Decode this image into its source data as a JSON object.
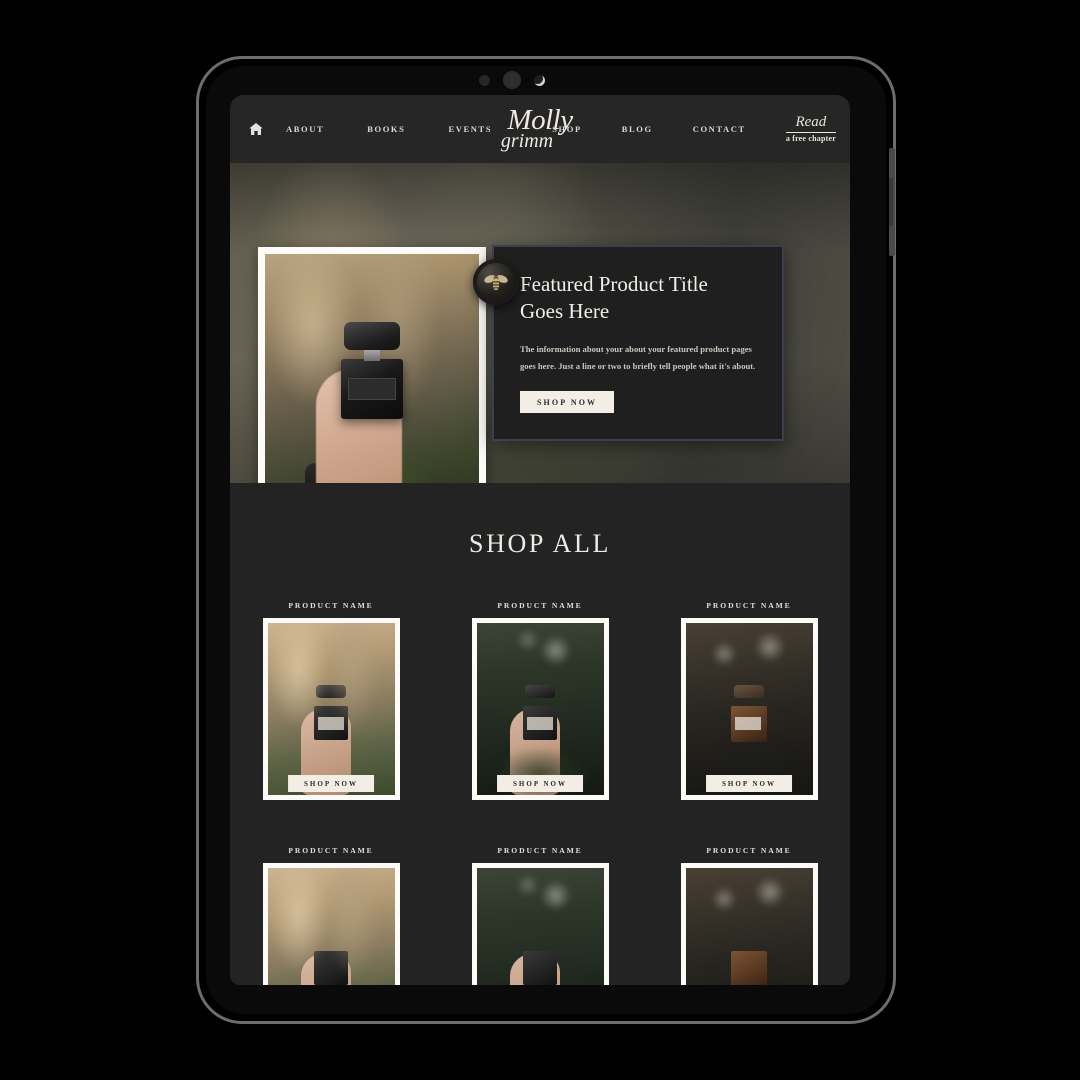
{
  "device": {
    "bezel_dots": [
      "sensor",
      "speaker",
      "camera"
    ]
  },
  "nav": {
    "home_icon": "home-icon",
    "left_links": [
      {
        "label": "ABOUT"
      },
      {
        "label": "BOOKS"
      },
      {
        "label": "EVENTS"
      }
    ],
    "right_links": [
      {
        "label": "SHOP"
      },
      {
        "label": "BLOG"
      },
      {
        "label": "CONTACT"
      }
    ],
    "brand": {
      "line1": "Molly",
      "line2": "grimm"
    },
    "cta": {
      "word": "Read",
      "sub": "a free chapter"
    }
  },
  "hero": {
    "seal_icon": "bee-icon",
    "photo_alt": "hand holding black perfume bottle in front of cathedral",
    "title": "Featured Product Title Goes Here",
    "description": "The information about your about your featured product pages goes here. Just a line or two to briefly tell people what it's about.",
    "button_label": "SHOP NOW"
  },
  "shop": {
    "heading": "SHOP ALL",
    "row1": [
      {
        "name": "PRODUCT NAME",
        "button": "SHOP NOW",
        "photo": "cathedral"
      },
      {
        "name": "PRODUCT NAME",
        "button": "SHOP NOW",
        "photo": "foliage"
      },
      {
        "name": "PRODUCT NAME",
        "button": "SHOP NOW",
        "photo": "gate"
      }
    ],
    "row2": [
      {
        "name": "PRODUCT NAME",
        "photo": "cathedral"
      },
      {
        "name": "PRODUCT NAME",
        "photo": "foliage"
      },
      {
        "name": "PRODUCT NAME",
        "photo": "gate"
      }
    ]
  },
  "colors": {
    "page_background": "#232323",
    "nav_background": "#262626",
    "cream": "#F2EDE5",
    "text_light": "#EFEAE2",
    "panel_border": "#3A4050",
    "device_frame": "#6D6D6D"
  }
}
